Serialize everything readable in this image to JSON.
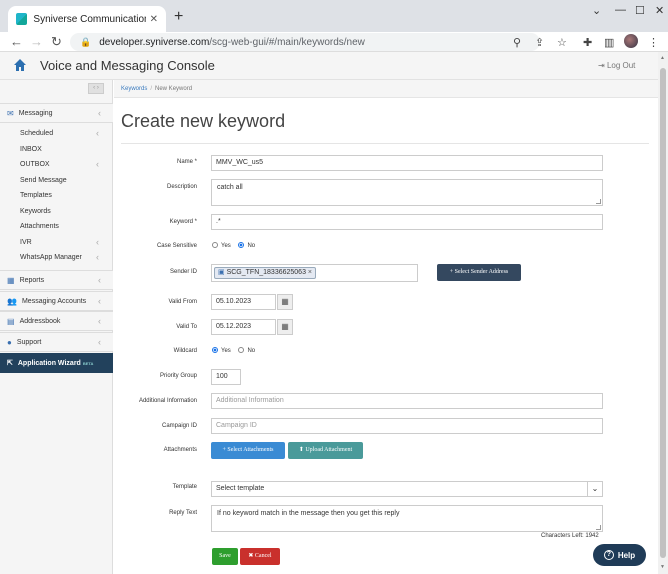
{
  "browser": {
    "tab_title": "Syniverse Communication Gatew",
    "url_host": "developer.syniverse.com",
    "url_path": "/scg-web-gui/#/main/keywords/new"
  },
  "app": {
    "title": "Voice and Messaging Console",
    "logout": "Log Out"
  },
  "sidebar": {
    "messaging": "Messaging",
    "items": [
      "Scheduled",
      "INBOX",
      "OUTBOX",
      "Send Message",
      "Templates",
      "Keywords",
      "Attachments",
      "IVR",
      "WhatsApp Manager"
    ],
    "reports": "Reports",
    "accounts": "Messaging Accounts",
    "addressbook": "Addressbook",
    "support": "Support",
    "wizard": "Application Wizard",
    "wizard_badge": "BETA"
  },
  "breadcrumb": {
    "link": "Keywords",
    "current": "New Keyword"
  },
  "page_title": "Create new keyword",
  "form": {
    "name_label": "Name *",
    "name_value": "MMV_WC_us5",
    "description_label": "Description",
    "description_value": "catch all",
    "keyword_label": "Keyword *",
    "keyword_value": ".*",
    "case_label": "Case Sensitive",
    "case_yes": "Yes",
    "case_no": "No",
    "sender_label": "Sender ID",
    "sender_tag": "SCG_TFN_18336625063",
    "select_sender": "Select Sender Address",
    "valid_from_label": "Valid From",
    "valid_from_value": "05.10.2023",
    "valid_to_label": "Valid To",
    "valid_to_value": "05.12.2023",
    "wildcard_label": "Wildcard",
    "wildcard_yes": "Yes",
    "wildcard_no": "No",
    "priority_label": "Priority Group",
    "priority_value": "100",
    "addinfo_label": "Additional Information",
    "addinfo_placeholder": "Additional Information",
    "campaign_label": "Campaign ID",
    "campaign_placeholder": "Campaign ID",
    "attachments_label": "Attachments",
    "select_attachments": "Select Attachments",
    "upload_attachment": "Upload Attachment",
    "template_label": "Template",
    "template_value": "Select template",
    "reply_label": "Reply Text",
    "reply_value": "If no keyword match in the message then you get this reply",
    "chars_left": "Characters Left: 1942",
    "save": "Save",
    "cancel": "Cancel"
  },
  "help": "Help",
  "colors": {
    "accent": "#22415c",
    "save": "#2e9e2e",
    "cancel": "#c9302c",
    "primary": "#3a8bd4",
    "upload": "#4a9a9a"
  }
}
